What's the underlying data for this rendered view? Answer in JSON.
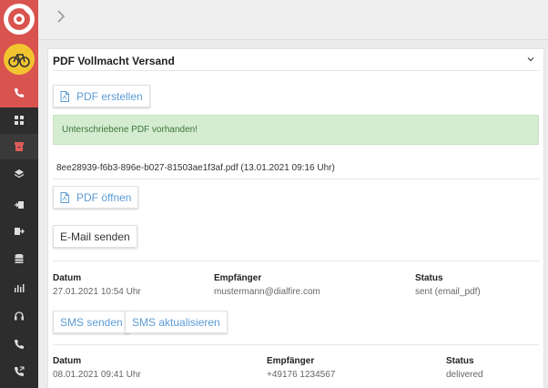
{
  "top": {
    "back_icon": "chevron-right-icon"
  },
  "sidebar": {
    "brand_color": "#d9534f",
    "items": [
      {
        "icon": "phone-icon"
      },
      {
        "icon": "dashboard-icon"
      },
      {
        "icon": "archive-icon"
      },
      {
        "icon": "layers-icon"
      },
      {
        "icon": "import-icon"
      },
      {
        "icon": "export-icon"
      },
      {
        "icon": "database-icon"
      },
      {
        "icon": "bar-chart-icon"
      },
      {
        "icon": "headset-icon"
      },
      {
        "icon": "phone-icon"
      },
      {
        "icon": "phone-forward-icon"
      }
    ]
  },
  "panel": {
    "title": "PDF Vollmacht Versand",
    "create_pdf_label": "PDF erstellen",
    "alert_text": "Unterschriebene PDF vorhanden!",
    "file_info": "8ee28939-f6b3-896e-b027-81503ae1f3af.pdf (13.01.2021 09:16 Uhr)",
    "open_pdf_label": "PDF öffnen",
    "send_email_label": "E-Mail senden",
    "email_log": {
      "headers": {
        "date": "Datum",
        "recipient": "Empfänger",
        "status": "Status"
      },
      "row": {
        "date": "27.01.2021 10:54 Uhr",
        "recipient": "mustermann@dialfire.com",
        "status": "sent (email_pdf)"
      }
    },
    "send_sms_label": "SMS senden",
    "update_sms_label": "SMS aktualisieren",
    "sms_log": {
      "headers": {
        "date": "Datum",
        "recipient": "Empfänger",
        "status": "Status"
      },
      "row": {
        "date": "08.01.2021 09:41 Uhr",
        "recipient": "+49176 1234567",
        "status": "delivered"
      }
    }
  }
}
